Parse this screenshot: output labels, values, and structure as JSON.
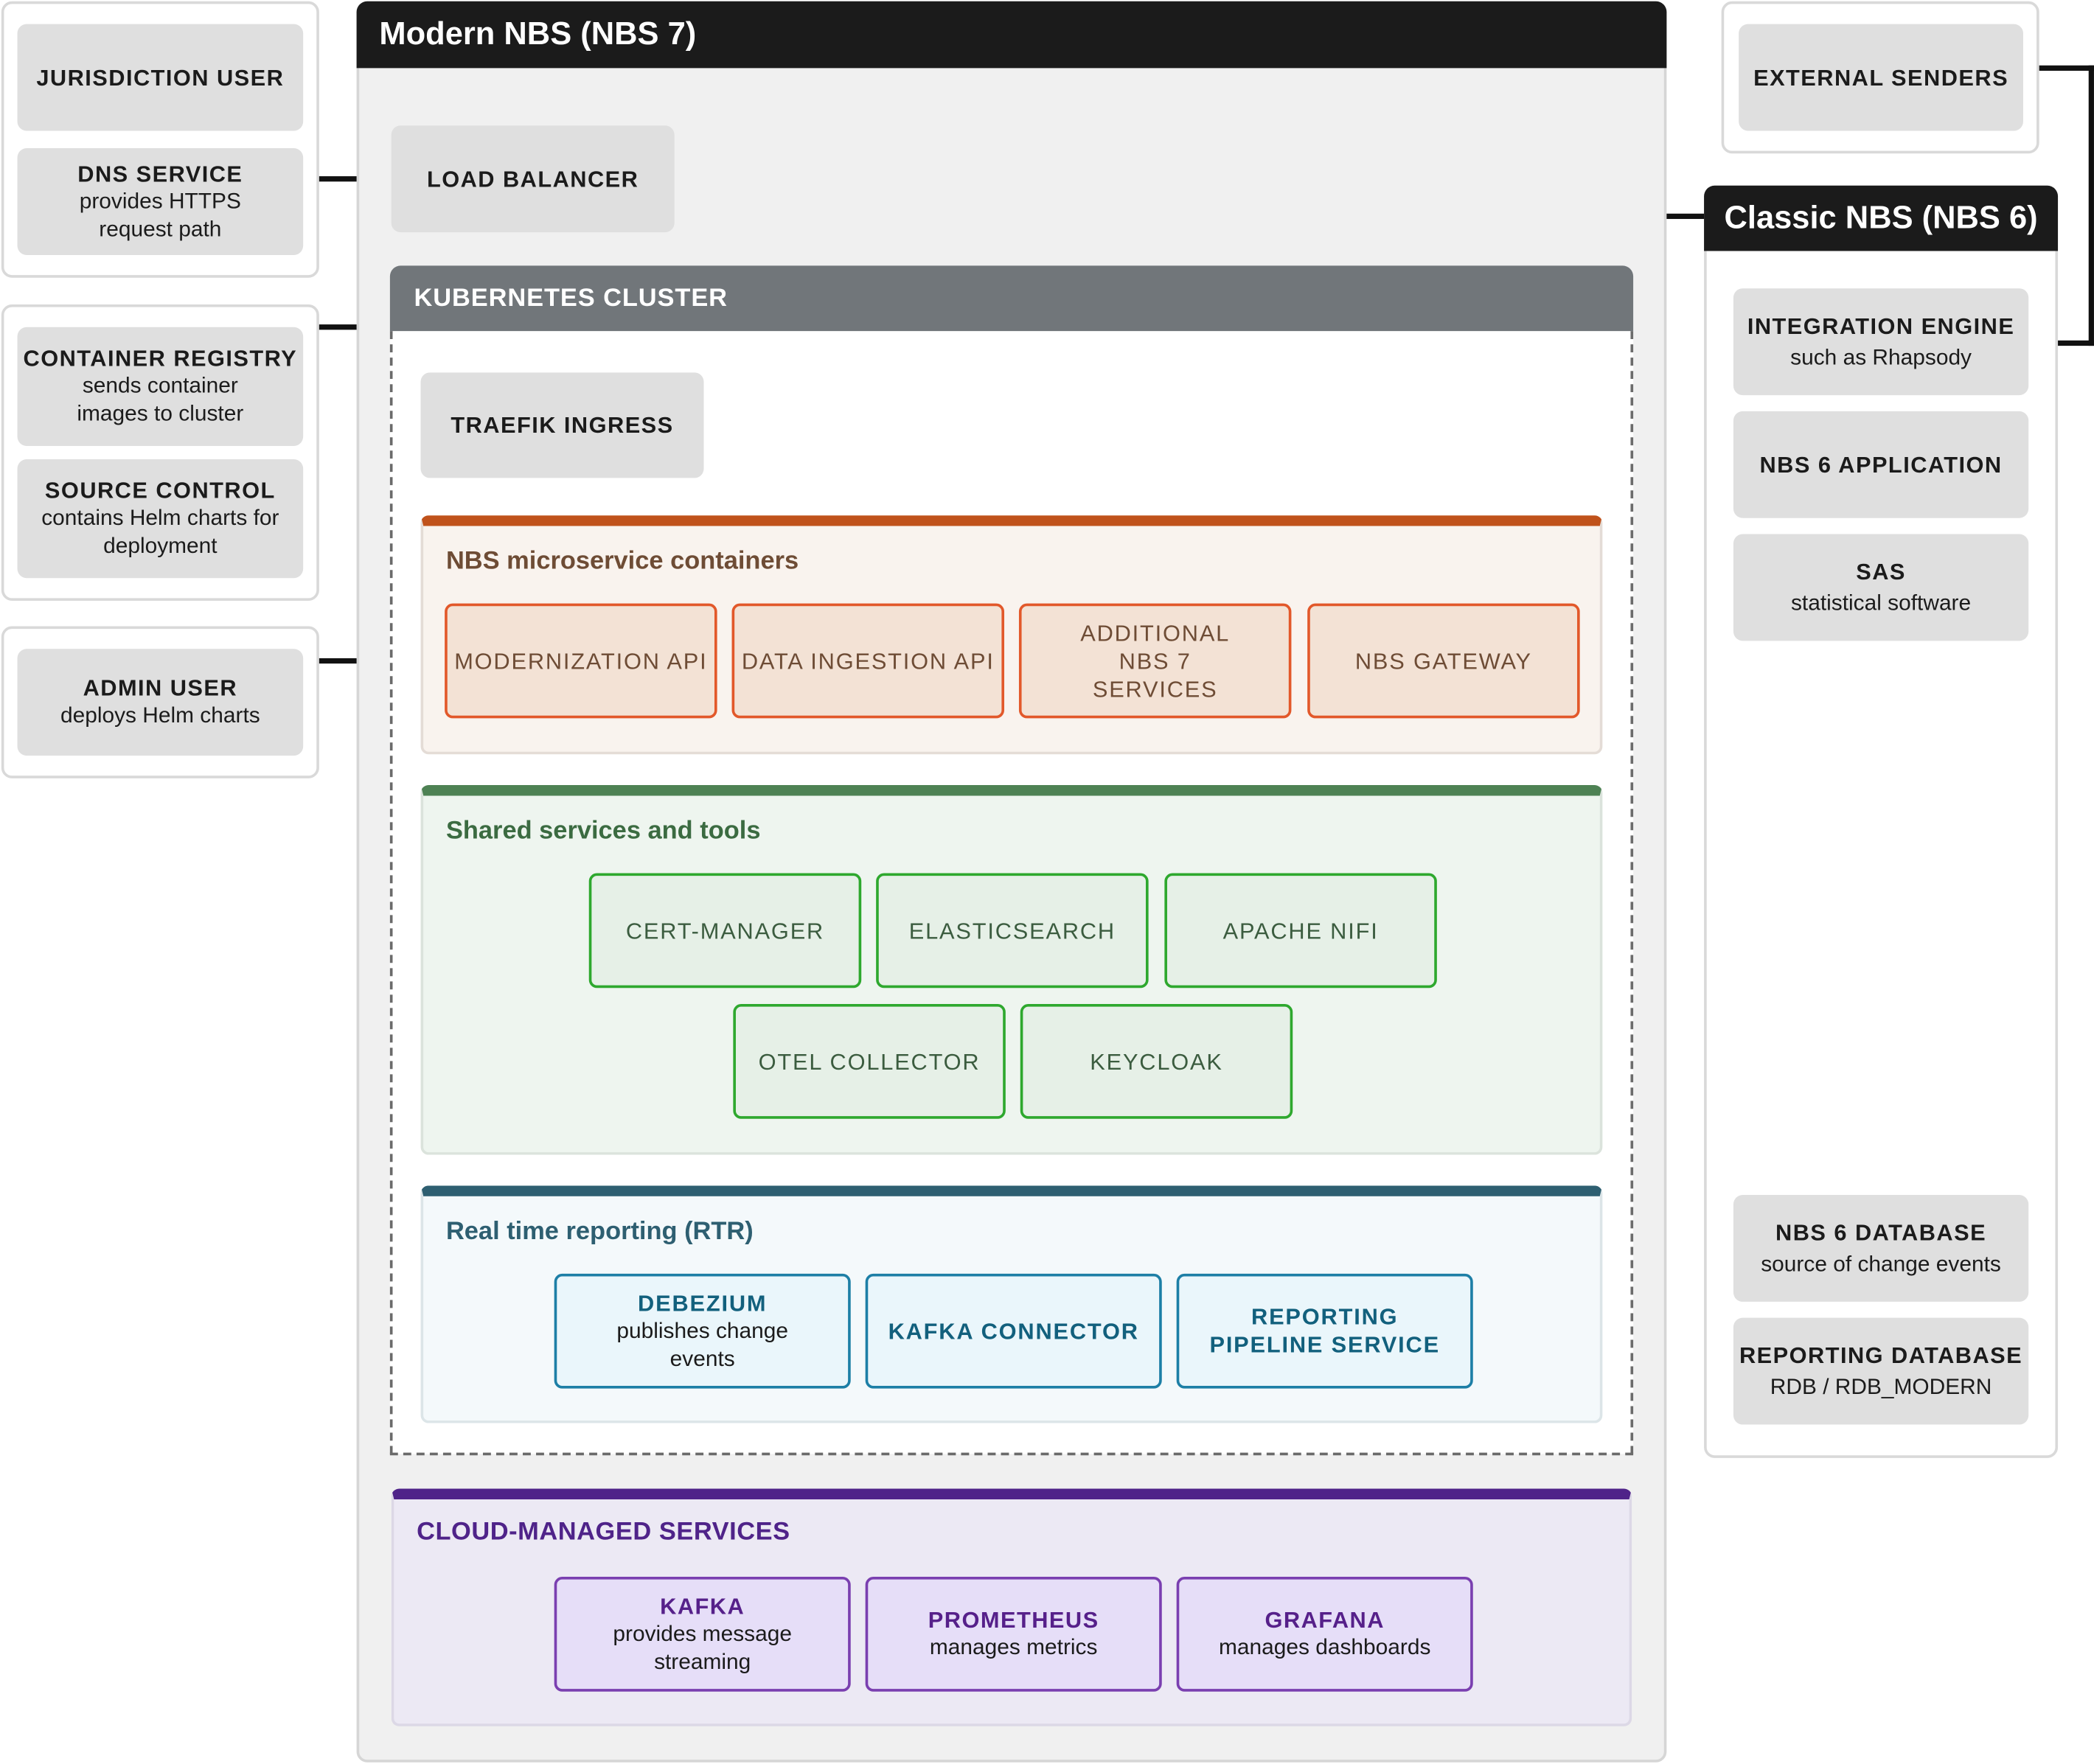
{
  "left": {
    "jurisdiction_user": "JURISDICTION USER",
    "dns_service": {
      "title": "DNS SERVICE",
      "desc": "provides HTTPS request path"
    },
    "container_registry": {
      "title": "CONTAINER REGISTRY",
      "desc": "sends container images to cluster"
    },
    "source_control": {
      "title": "SOURCE CONTROL",
      "desc": "contains Helm charts for deployment"
    },
    "admin_user": {
      "title": "ADMIN USER",
      "desc": "deploys Helm charts"
    }
  },
  "modern": {
    "title": "Modern NBS (NBS 7)",
    "load_balancer": "LOAD BALANCER",
    "cluster": {
      "title": "KUBERNETES CLUSTER",
      "ingress": "TRAEFIK INGRESS",
      "microservices": {
        "title": "NBS microservice containers",
        "items": [
          "MODERNIZATION API",
          "DATA INGESTION API",
          "ADDITIONAL NBS 7 SERVICES",
          "NBS GATEWAY"
        ]
      },
      "shared": {
        "title": "Shared services and tools",
        "items": [
          "CERT-MANAGER",
          "ELASTICSEARCH",
          "APACHE NIFI",
          "OTEL COLLECTOR",
          "KEYCLOAK"
        ]
      },
      "rtr": {
        "title": "Real time reporting (RTR)",
        "debezium": {
          "title": "DEBEZIUM",
          "desc": "publishes change events"
        },
        "kafka_connector": "KAFKA CONNECTOR",
        "reporting_pipeline": "REPORTING PIPELINE SERVICE"
      }
    },
    "cloud": {
      "title": "CLOUD-MANAGED SERVICES",
      "kafka": {
        "title": "KAFKA",
        "desc": "provides message streaming"
      },
      "prometheus": {
        "title": "PROMETHEUS",
        "desc": "manages metrics"
      },
      "grafana": {
        "title": "GRAFANA",
        "desc": "manages dashboards"
      }
    }
  },
  "right": {
    "external_senders": "EXTERNAL SENDERS",
    "classic": {
      "title": "Classic NBS (NBS 6)",
      "integration_engine": {
        "title": "INTEGRATION ENGINE",
        "desc": "such as Rhapsody"
      },
      "nbs6_application": "NBS 6 APPLICATION",
      "sas": {
        "title": "SAS",
        "desc": "statistical software"
      },
      "nbs6_database": {
        "title": "NBS 6 DATABASE",
        "desc": "source of change events"
      },
      "reporting_database": {
        "title": "REPORTING DATABASE",
        "desc": "RDB / RDB_MODERN"
      }
    }
  },
  "colors": {
    "orange": "#c0521b",
    "green": "#4e8254",
    "blue": "#2e5f71",
    "purple": "#4f2389",
    "black": "#1b1b1b"
  }
}
